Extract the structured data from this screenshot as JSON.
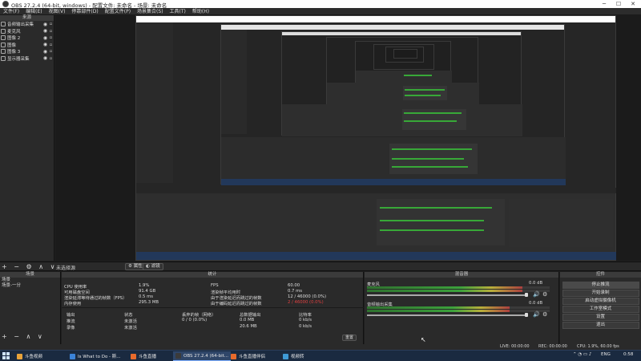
{
  "window": {
    "title": "OBS 27.2.4 (64-bit, windows) - 配置文件: 未命名 - 场景: 未命名",
    "controls": [
      "─",
      "☐",
      "✕"
    ]
  },
  "menu": [
    "文件(F)",
    "编辑(E)",
    "视图(V)",
    "停靠部件(D)",
    "配置文件(P)",
    "场景集合(S)",
    "工具(T)",
    "帮助(H)"
  ],
  "sources": {
    "header": "来源",
    "items": [
      {
        "label": "音频输出采集",
        "icon": "speaker-icon"
      },
      {
        "label": "麦克风",
        "icon": "mic-icon"
      },
      {
        "label": "图像 2",
        "icon": "image-icon"
      },
      {
        "label": "图像",
        "icon": "image-icon"
      },
      {
        "label": "图像 3",
        "icon": "image-icon"
      },
      {
        "label": "显示器采集",
        "icon": "monitor-icon"
      }
    ]
  },
  "controlbar": {
    "toolbar_symbols": "+ − ⚙ ∧ ∨",
    "no_source": "未选择源",
    "properties": "属性",
    "filters": "滤镜"
  },
  "scenes": {
    "header": "场景",
    "items": [
      "场景",
      "场景-一分"
    ],
    "toolbar_symbols": "+ − ∧ ∨"
  },
  "stats": {
    "header": "统计",
    "left": [
      {
        "label": "CPU 使用率",
        "value": "1.9%"
      },
      {
        "label": "可用磁盘空间",
        "value": "91.4 GB"
      },
      {
        "label": "渲染延滞等待通过的帧数（FPS）",
        "value": "0.5 ms"
      },
      {
        "label": "内存使用",
        "value": "295.3 MB"
      }
    ],
    "right": [
      {
        "label": "FPS",
        "value": "60.00"
      },
      {
        "label": "渲染帧平均用时",
        "value": "0.7 ms"
      },
      {
        "label": "由于渲染延迟而跳过的帧数",
        "value": "12 / 46000 (0.0%)"
      },
      {
        "label": "由于编码延迟而跳过的帧数",
        "value": "2 / 46000 (0.0%)",
        "red": true
      }
    ],
    "output_headers": [
      "输出",
      "状态",
      "丢弃的帧（网络）",
      "总数据输出",
      "比特率"
    ],
    "outputs": [
      [
        "推流",
        "未激活",
        "0 / 0 (0.0%)",
        "0.0 MB",
        "0 kb/s"
      ],
      [
        "录像",
        "未激活",
        "",
        "20.6 MB",
        "0 kb/s"
      ]
    ],
    "reset": "重置"
  },
  "mixer": {
    "header": "混音器",
    "channels": [
      {
        "name": "麦克风",
        "db": "0.0 dB",
        "level": 0.85
      },
      {
        "name": "音频输出采集",
        "db": "0.0 dB",
        "level": 0.78
      }
    ]
  },
  "controls": {
    "header": "控件",
    "buttons": [
      "停止推流",
      "开始录制",
      "启动虚拟摄像机",
      "工作室模式",
      "设置",
      "退出"
    ]
  },
  "statusbar": {
    "live": "LIVE: 00:00:00",
    "rec": "REC: 00:00:00",
    "cpu": "CPU: 1.9%, 60.00 fps"
  },
  "taskbar": {
    "apps": [
      {
        "label": "斗鱼视频",
        "color": "#e7a23a"
      },
      {
        "label": "Is What to Do - 斯...",
        "color": "#3b83d9"
      },
      {
        "label": "斗鱼直播",
        "color": "#e66a2c"
      },
      {
        "label": "OBS 27.2.4 (64-bit...",
        "color": "#3b3b3b",
        "active": true
      },
      {
        "label": "斗鱼直播伴侣",
        "color": "#e66a2c"
      },
      {
        "label": "视频转",
        "color": "#3f9ad6"
      }
    ],
    "tray": {
      "lang": "ENG",
      "time": "0:58"
    }
  }
}
